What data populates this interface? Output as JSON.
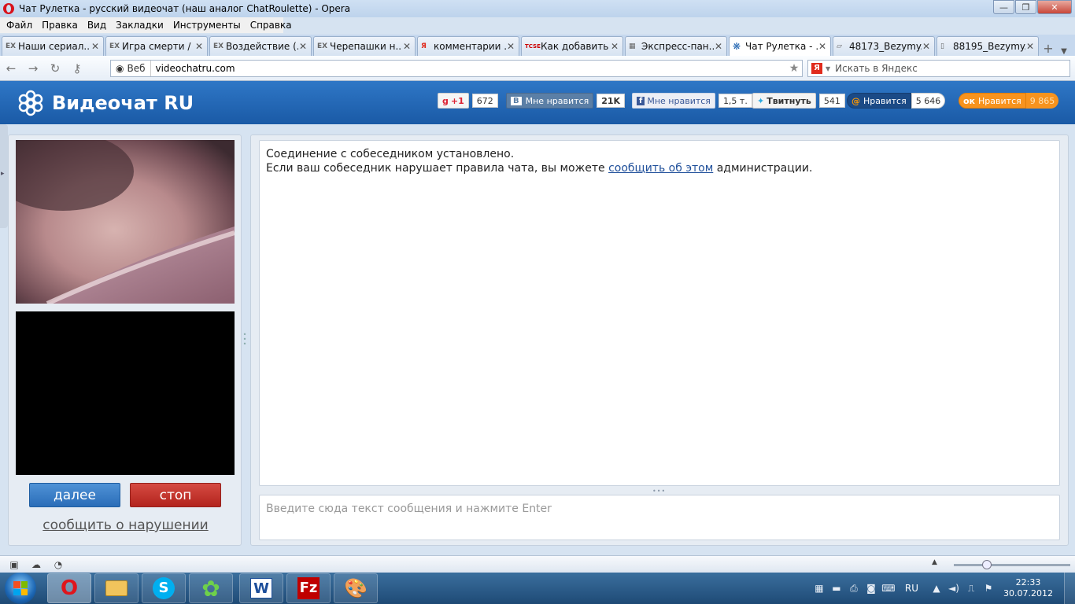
{
  "window": {
    "title": "Чат Рулетка - русский видеочат (наш аналог ChatRoulette) - Opera",
    "minimize": "—",
    "maximize": "❐",
    "close": "✕"
  },
  "menu": [
    "Файл",
    "Правка",
    "Вид",
    "Закладки",
    "Инструменты",
    "Справка"
  ],
  "tabs": [
    {
      "icon": "EX",
      "label": "Наши сериал...",
      "active": false
    },
    {
      "icon": "EX",
      "label": "Игра смерти / ...",
      "active": false
    },
    {
      "icon": "EX",
      "label": "Воздействие (...",
      "active": false
    },
    {
      "icon": "EX",
      "label": "Черепашки н...",
      "active": false
    },
    {
      "icon": "Я",
      "label": "комментарии ...",
      "active": false
    },
    {
      "icon": "TCSE",
      "label": "Как добавить ...",
      "active": false
    },
    {
      "icon": "▦",
      "label": "Экспресс-пан...",
      "active": false
    },
    {
      "icon": "❋",
      "label": "Чат Рулетка - ...",
      "active": true
    },
    {
      "icon": "▱",
      "label": "48173_Bezymy...",
      "active": false
    },
    {
      "icon": "▯",
      "label": "88195_Bezymy...",
      "active": false
    }
  ],
  "address": {
    "web_label": "Веб",
    "url": "videochatru.com",
    "search_placeholder": "Искать в Яндекс"
  },
  "site": {
    "title": "Видеочат RU",
    "brand_color": "#1f63b0",
    "social": {
      "gplus_label": "+1",
      "gplus_count": "672",
      "vk_label": "Мне нравится",
      "vk_count": "21K",
      "fb_label": "Мне нравится",
      "fb_count": "1,5 т.",
      "tw_label": "Твитнуть",
      "tw_count": "541",
      "mail_label": "Нравится",
      "mail_count": "5 646",
      "ok_label": "Нравится",
      "ok_count": "9 865"
    }
  },
  "controls": {
    "next_label": "далее",
    "stop_label": "стоп",
    "report_label": "сообщить о нарушении"
  },
  "chat": {
    "line1": "Соединение с собеседником установлено.",
    "line2_before": "Если ваш собеседник нарушает правила чата, вы можете ",
    "line2_link": "сообщить об этом",
    "line2_after": " администрации.",
    "input_placeholder": "Введите сюда текст сообщения и нажмите Enter"
  },
  "taskbar": {
    "apps": [
      "opera",
      "explorer",
      "skype",
      "icq",
      "word",
      "filezilla",
      "paint"
    ],
    "lang": "RU",
    "time": "22:33",
    "date": "30.07.2012"
  }
}
